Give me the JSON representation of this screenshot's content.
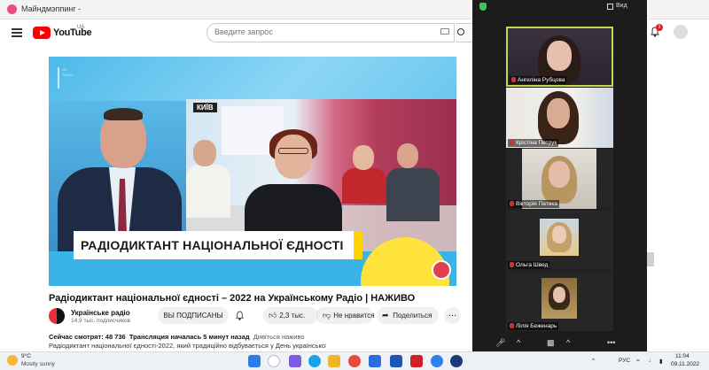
{
  "browser": {
    "tab_title": "Майндмэппинг -"
  },
  "youtube": {
    "logo_text": "YouTube",
    "region": "UA",
    "search_placeholder": "Введите запрос",
    "notification_count": "3"
  },
  "video": {
    "location_tag": "КИЇВ",
    "board_text": "РАДІО\nДИКТАНТ\nНАЦІОНАЛЬНОЇ\nЄДНОСТІ",
    "lower_third": "РАДІОДИКТАНТ НАЦІОНАЛЬНОЇ ЄДНОСТІ",
    "title": "Радіодиктант національної єдності – 2022 на Українському Радіо | НАЖИВО",
    "channel_name": "Українське радіо",
    "channel_subs": "14,9 тыс. подписчиков",
    "subscribe_label": "ВЫ ПОДПИСАНЫ",
    "like_count": "2,3 тыс.",
    "dislike_label": "Не нравится",
    "share_label": "Поделиться",
    "watching_now": "Сейчас смотрят: 48 736",
    "started": "Трансляция началась 5 минут назад",
    "tag_live": "Дивіться наживо",
    "description": "Радіодиктант національної єдності-2022, який традиційно відбувається у День української"
  },
  "zoom": {
    "view_label": "Вид",
    "participants": [
      {
        "name": "Ангеліна Рубцова",
        "active": true
      },
      {
        "name": "Крістіна Петрук",
        "active": false
      },
      {
        "name": "Вікторія Патика",
        "active": false
      },
      {
        "name": "Ольга Швед",
        "active": false
      },
      {
        "name": "Лілія Беженарь",
        "active": false
      }
    ]
  },
  "taskbar": {
    "temperature": "9°C",
    "condition": "Mostly sunny",
    "language": "РУС",
    "time": "11:04",
    "date": "09.11.2022"
  },
  "colors": {
    "youtube_red": "#ff0000",
    "zoom_bg": "#1c1c1c",
    "active_speaker": "#c7d74b",
    "lower_third_yellow": "#ffd400"
  }
}
